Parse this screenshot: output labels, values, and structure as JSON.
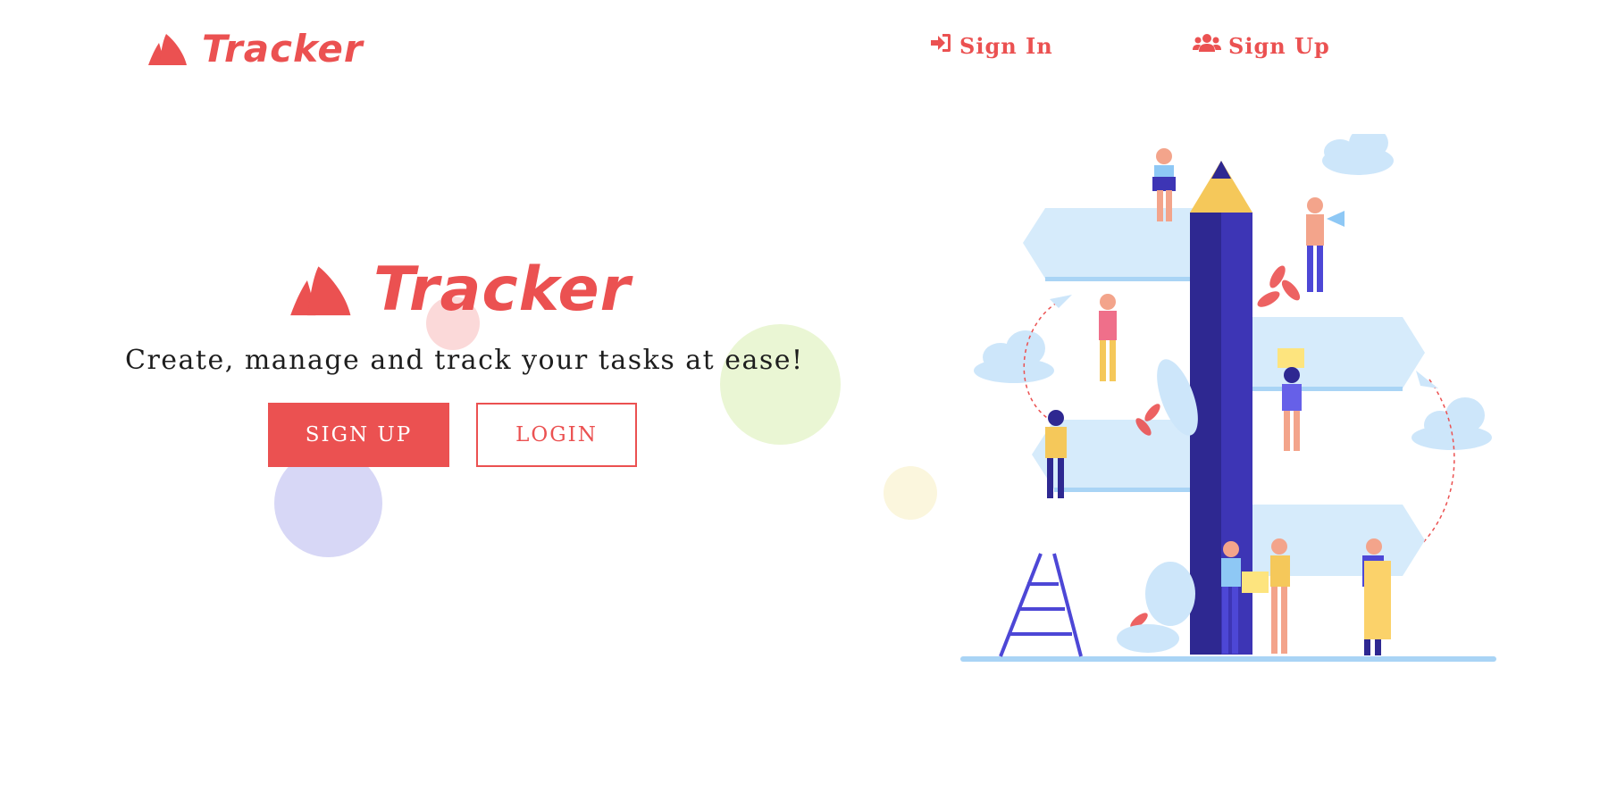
{
  "nav": {
    "brand": "Tracker",
    "sign_in_label": "Sign In",
    "sign_up_label": "Sign Up",
    "sign_in_icon": "sign-in-icon",
    "sign_up_icon": "users-icon"
  },
  "hero": {
    "brand": "Tracker",
    "tagline": "Create, manage and track your tasks at ease!",
    "sign_up_button": "SIGN UP",
    "login_button": "LOGIN"
  },
  "colors": {
    "accent": "#eb5151",
    "illustration_pencil": "#3d35b5",
    "illustration_sign": "#d6ebfb"
  }
}
